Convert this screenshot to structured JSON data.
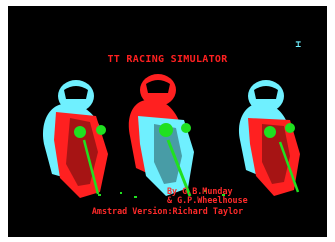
{
  "game": {
    "title": "TT RACING SIMULATOR",
    "corner_glyph": "⌶",
    "credits_line1": "By G.B.Munday",
    "credits_line2": "& G.P.Wheelhouse",
    "version_line": "Amstrad Version:Richard Taylor"
  },
  "colors": {
    "background": "#000000",
    "text": "#ff2a2a",
    "cyan": "#6ff0ff",
    "red": "#ff2020",
    "green": "#20e020",
    "white": "#ffffff"
  }
}
